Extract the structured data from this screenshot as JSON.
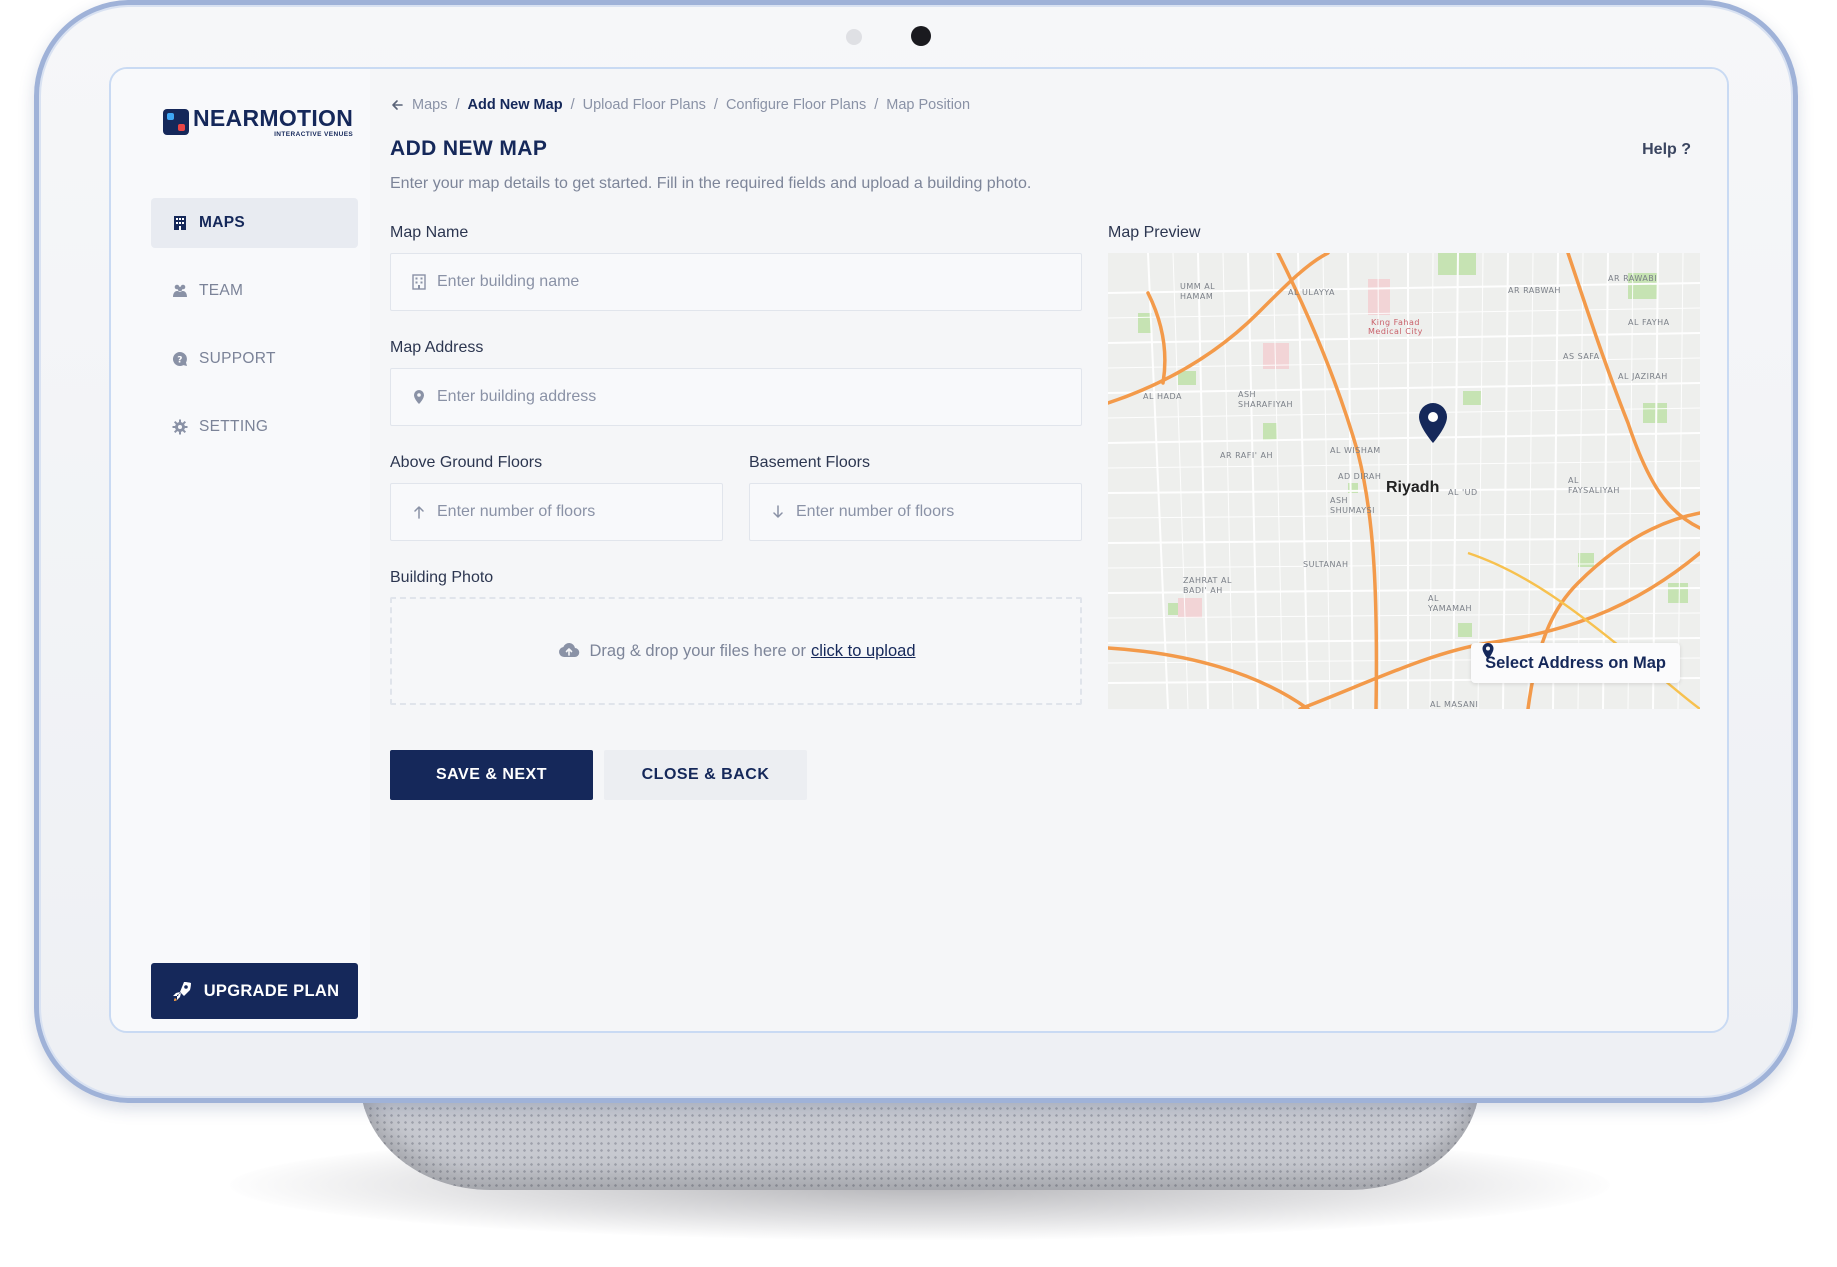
{
  "brand": {
    "name": "NEARMOTION",
    "tagline": "INTERACTIVE VENUES"
  },
  "nav": {
    "items": [
      {
        "label": "MAPS",
        "icon": "building-icon",
        "active": true
      },
      {
        "label": "TEAM",
        "icon": "team-icon",
        "active": false
      },
      {
        "label": "SUPPORT",
        "icon": "support-icon",
        "active": false
      },
      {
        "label": "SETTING",
        "icon": "gear-icon",
        "active": false
      }
    ],
    "upgrade_label": "UPGRADE PLAN"
  },
  "breadcrumb": [
    "Maps",
    "Add New Map",
    "Upload Floor Plans",
    "Configure Floor Plans",
    "Map Position"
  ],
  "header": {
    "title": "ADD NEW MAP",
    "subtitle": "Enter your map details to get started. Fill in the required fields and upload a building photo.",
    "help": "Help ?"
  },
  "form": {
    "map_name": {
      "label": "Map Name",
      "placeholder": "Enter building name"
    },
    "map_address": {
      "label": "Map Address",
      "placeholder": "Enter building address"
    },
    "above_floors": {
      "label": "Above Ground Floors",
      "placeholder": "Enter number of floors"
    },
    "basement_floors": {
      "label": "Basement Floors",
      "placeholder": "Enter number of floors"
    },
    "photo": {
      "label": "Building Photo",
      "text": "Drag & drop your files here or",
      "link": "click to upload"
    }
  },
  "actions": {
    "save": "SAVE & NEXT",
    "close": "CLOSE & BACK"
  },
  "map": {
    "label": "Map Preview",
    "city": "Riyadh",
    "select_label": "Select Address on Map"
  },
  "colors": {
    "primary": "#15285a",
    "road": "#f39a4a",
    "park": "#b9dfa4",
    "pin": "#15285a"
  }
}
